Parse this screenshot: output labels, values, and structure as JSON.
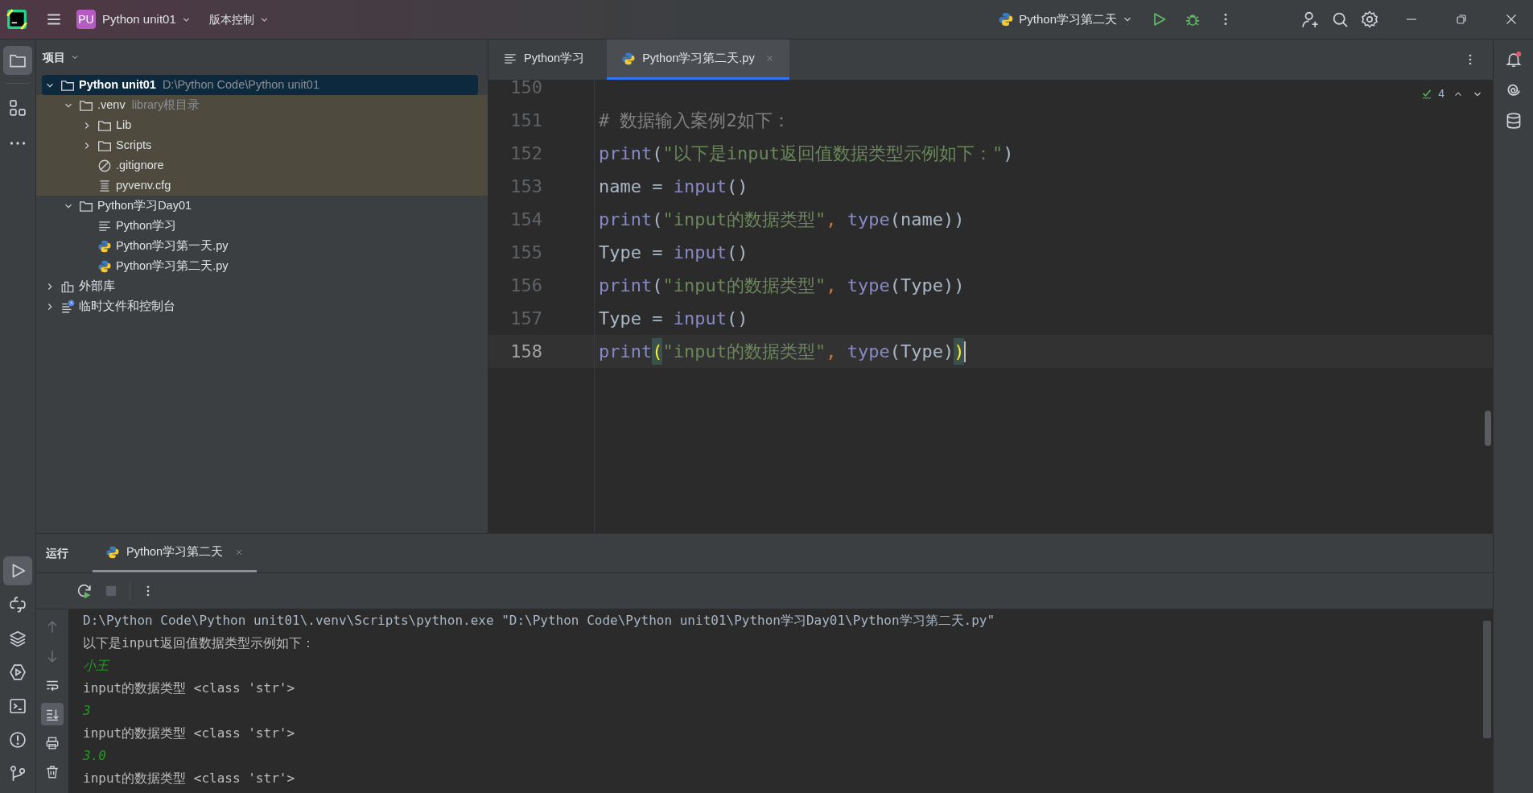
{
  "title_bar": {
    "project_badge": "PU",
    "project": "Python unit01",
    "vcs": "版本控制",
    "run_config": "Python学习第二天"
  },
  "project_panel": {
    "title": "项目",
    "tree": [
      {
        "label": "Python unit01",
        "hint": "D:\\Python Code\\Python unit01",
        "kind": "folder",
        "expanded": true,
        "selected": true,
        "highlighted": false,
        "children": [
          {
            "label": ".venv",
            "hint": "library根目录",
            "kind": "folder",
            "expanded": true,
            "selected": false,
            "highlighted": true,
            "children": [
              {
                "label": "Lib",
                "kind": "folder",
                "expanded": false,
                "selected": false,
                "highlighted": true
              },
              {
                "label": "Scripts",
                "kind": "folder",
                "expanded": false,
                "selected": false,
                "highlighted": true
              },
              {
                "label": ".gitignore",
                "kind": "ignore",
                "selected": false,
                "highlighted": true
              },
              {
                "label": "pyvenv.cfg",
                "kind": "config",
                "selected": false,
                "highlighted": true
              }
            ]
          },
          {
            "label": "Python学习Day01",
            "kind": "folder",
            "expanded": true,
            "selected": false,
            "highlighted": false,
            "children": [
              {
                "label": "Python学习",
                "kind": "text",
                "selected": false,
                "highlighted": false
              },
              {
                "label": "Python学习第一天.py",
                "kind": "python",
                "selected": false,
                "highlighted": false
              },
              {
                "label": "Python学习第二天.py",
                "kind": "python",
                "selected": false,
                "highlighted": false
              }
            ]
          }
        ]
      },
      {
        "label": "外部库",
        "kind": "library",
        "expanded": false,
        "selected": false,
        "highlighted": false
      },
      {
        "label": "临时文件和控制台",
        "kind": "scratch",
        "expanded": false,
        "selected": false,
        "highlighted": false
      }
    ]
  },
  "editor": {
    "tabs": [
      {
        "label": "Python学习",
        "kind": "text",
        "selected": false,
        "closable": false
      },
      {
        "label": "Python学习第二天.py",
        "kind": "python",
        "selected": true,
        "closable": true
      }
    ],
    "inspections": "4",
    "lines": [
      {
        "number": "150",
        "current": false
      },
      {
        "number": "151",
        "current": false,
        "tokens": [
          {
            "kind": "comment",
            "text": "# 数据输入案例2如下："
          }
        ]
      },
      {
        "number": "152",
        "current": false,
        "tokens": [
          {
            "kind": "builtin",
            "text": "print"
          },
          {
            "kind": "plain",
            "text": "("
          },
          {
            "kind": "string",
            "text": "\"以下是input返回值数据类型示例如下：\""
          },
          {
            "kind": "plain",
            "text": ")"
          }
        ]
      },
      {
        "number": "153",
        "current": false,
        "tokens": [
          {
            "kind": "plain",
            "text": "name = "
          },
          {
            "kind": "builtin",
            "text": "input"
          },
          {
            "kind": "plain",
            "text": "()"
          }
        ]
      },
      {
        "number": "154",
        "current": false,
        "tokens": [
          {
            "kind": "builtin",
            "text": "print"
          },
          {
            "kind": "plain",
            "text": "("
          },
          {
            "kind": "string",
            "text": "\"input的数据类型\""
          },
          {
            "kind": "comma",
            "text": ", "
          },
          {
            "kind": "builtin",
            "text": "type"
          },
          {
            "kind": "plain",
            "text": "(name))"
          }
        ]
      },
      {
        "number": "155",
        "current": false,
        "tokens": [
          {
            "kind": "plain",
            "text": "Type = "
          },
          {
            "kind": "builtin",
            "text": "input"
          },
          {
            "kind": "plain",
            "text": "()"
          }
        ]
      },
      {
        "number": "156",
        "current": false,
        "tokens": [
          {
            "kind": "builtin",
            "text": "print"
          },
          {
            "kind": "plain",
            "text": "("
          },
          {
            "kind": "string",
            "text": "\"input的数据类型\""
          },
          {
            "kind": "comma",
            "text": ", "
          },
          {
            "kind": "builtin",
            "text": "type"
          },
          {
            "kind": "plain",
            "text": "(Type))"
          }
        ]
      },
      {
        "number": "157",
        "current": false,
        "tokens": [
          {
            "kind": "plain",
            "text": "Type = "
          },
          {
            "kind": "builtin",
            "text": "input"
          },
          {
            "kind": "plain",
            "text": "()"
          }
        ]
      },
      {
        "number": "158",
        "current": true,
        "tokens": [
          {
            "kind": "builtin",
            "text": "print"
          },
          {
            "kind": "brace-match",
            "text": "("
          },
          {
            "kind": "string",
            "text": "\"input的数据类型\""
          },
          {
            "kind": "comma",
            "text": ", "
          },
          {
            "kind": "builtin",
            "text": "type"
          },
          {
            "kind": "plain",
            "text": "(Type)"
          },
          {
            "kind": "brace-match",
            "text": ")"
          }
        ]
      }
    ]
  },
  "run_panel": {
    "title": "运行",
    "tabs": [
      {
        "label": "Python学习第二天",
        "selected": true
      }
    ],
    "console": [
      {
        "kind": "command",
        "text": "D:\\Python Code\\Python unit01\\.venv\\Scripts\\python.exe \"D:\\Python Code\\Python unit01\\Python学习Day01\\Python学习第二天.py\""
      },
      {
        "kind": "output",
        "text": "以下是input返回值数据类型示例如下："
      },
      {
        "kind": "input",
        "text": "小王"
      },
      {
        "kind": "output",
        "text": "input的数据类型 <class 'str'>"
      },
      {
        "kind": "input",
        "text": "3"
      },
      {
        "kind": "output",
        "text": "input的数据类型 <class 'str'>"
      },
      {
        "kind": "input",
        "text": "3.0"
      },
      {
        "kind": "output",
        "text": "input的数据类型 <class 'str'>"
      }
    ]
  }
}
